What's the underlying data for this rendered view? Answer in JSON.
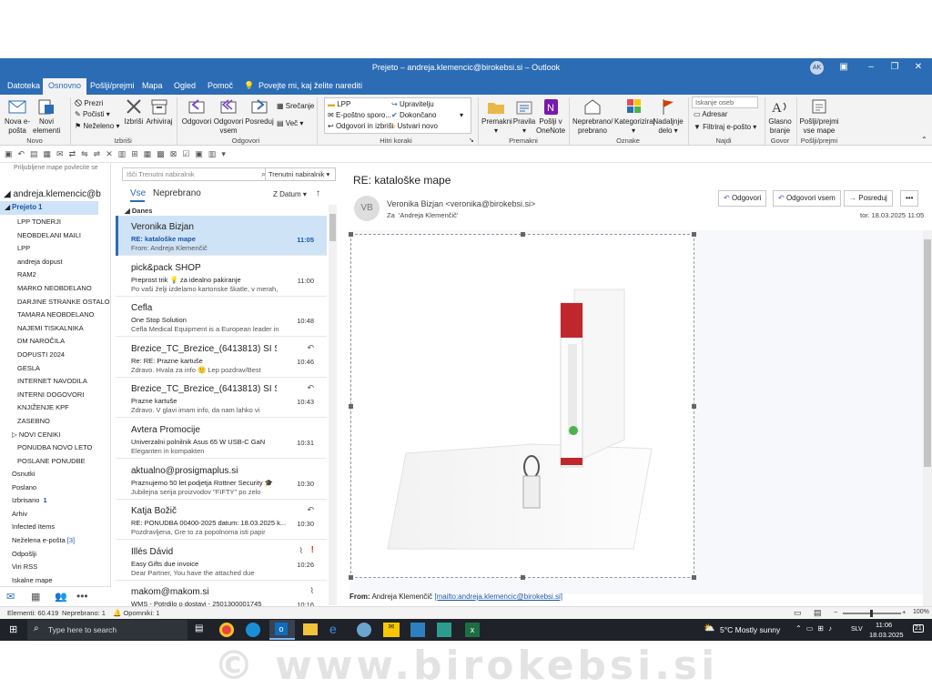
{
  "window": {
    "title": "Prejeto – andreja.klemencic@birokebsi.si – Outlook",
    "avatar_initials": "AK"
  },
  "tabs": [
    "Datoteka",
    "Osnovno",
    "Pošlji/prejmi",
    "Mapa",
    "Ogled",
    "Pomoč"
  ],
  "tell_me": "Povejte mi, kaj želite narediti",
  "ribbon": {
    "new_email": "Nova e-pošta",
    "new_items": "Novi elementi",
    "group_new": "Novo",
    "ignore": "Prezri",
    "clean": "Počisti",
    "junk": "Neželeno",
    "delete": "Izbriši",
    "archive": "Arhiviraj",
    "group_delete": "Izbriši",
    "reply": "Odgovori",
    "reply_all": "Odgovori vsem",
    "forward": "Posreduj",
    "meeting": "Srečanje",
    "more": "Več",
    "group_respond": "Odgovori",
    "qs_lpp": "LPP",
    "qs_email_manager": "E-poštno sporo...",
    "qs_reply_delete": "Odgovori in izbriši",
    "qs_manager": "Upravitelju",
    "qs_done": "Dokončano",
    "qs_create_new": "Ustvari novo",
    "group_quicksteps": "Hitri koraki",
    "move": "Premakni",
    "rules": "Pravila",
    "onenote": "Pošlji v OneNote",
    "group_move": "Premakni",
    "unread_read": "Neprebrano/ prebrano",
    "categorize": "Kategoriziraj",
    "followup": "Nadaljnje delo",
    "group_tags": "Oznake",
    "search_people": "Iskanje oseb",
    "address_book": "Adresar",
    "filter_email": "Filtriraj e-pošto",
    "group_find": "Najdi",
    "read_aloud": "Glasno branje",
    "group_speech": "Govor",
    "send_receive_all": "Pošlji/prejmi vse mape",
    "group_send_receive": "Pošlji/prejmi"
  },
  "nav": {
    "favorites_hint": "Priljubljene mape povlecite se",
    "account": "andreja.klemencic@b",
    "inbox": "Prejeto",
    "inbox_count": "1",
    "folders": [
      "LPP TONERJI",
      "NEOBDELANI MAILI",
      "LPP",
      "andreja dopust",
      "RAM2",
      "MARKO NEOBDELANO",
      "DARJINE STRANKE OSTALO",
      "TAMARA NEOBDELANO",
      "NAJEMI TISKALNIKA",
      "DM NAROČILA",
      "DOPUSTI 2024",
      "GESLA",
      "INTERNET NAVODILA",
      "INTERNI DOGOVORI",
      "KNJIŽENJE KPF",
      "ZASEBNO",
      "NOVI CENIKI",
      "PONUDBA NOVO LETO",
      "POSLANE PONUDBE"
    ],
    "top_folders": [
      "Osnutki",
      "Poslano",
      "Izbrisano",
      "Arhiv",
      "Infected Items",
      "Neželena e-pošta",
      "Odpošlji",
      "Viri RSS",
      "Iskalne mape"
    ],
    "deleted_count": "1",
    "junk_count": "[3]"
  },
  "list": {
    "search_placeholder": "Išči Trenutni nabiralnik",
    "scope": "Trenutni nabiralnik",
    "filter_all": "Vse",
    "filter_unread": "Neprebrano",
    "sort": "Z Datum",
    "group_today": "Danes",
    "messages": [
      {
        "from": "Veronika Bizjan",
        "subject": "RE: kataloške mape",
        "preview": "From: Andreja Klemenčič",
        "time": "11:05"
      },
      {
        "from": "pick&pack SHOP",
        "subject": "Preprost trik 💡 za idealno pakiranje",
        "preview": "Po vaši želji izdelamo kartonske škatle, v merah,",
        "time": "11:00"
      },
      {
        "from": "Cefla",
        "subject": "One Stop Solution",
        "preview": "Cefla Medical Equipment is a European leader in",
        "time": "10:48"
      },
      {
        "from": "Brezice_TC_Brezice_(6413813) SI Slo...",
        "subject": "Re: RE: Prazne kartuše",
        "preview": "Zdravo. Hvala za info 🙂 Lep pozdrav/Best",
        "time": "10:46"
      },
      {
        "from": "Brezice_TC_Brezice_(6413813) SI Slo...",
        "subject": "Prazne kartuše",
        "preview": "Zdravo. V glavi imam info, da nam lahko vi",
        "time": "10:43"
      },
      {
        "from": "Avtera Promocije",
        "subject": "Univerzalni polnilnik Asus 65 W USB-C GaN",
        "preview": "Eleganten in kompakten",
        "time": "10:31"
      },
      {
        "from": "aktualno@prosigmaplus.si",
        "subject": "Praznujemo 50 let podjetja Rottner Security 🎓",
        "preview": "Jubilejna serija proizvodov \"FIFTY\" po zelo",
        "time": "10:30"
      },
      {
        "from": "Katja Božič",
        "subject": "RE: PONUDBA 00400-2025 datum: 18.03.2025 k...",
        "preview": "Pozdravljena, Gre to za popolnoma isti papir",
        "time": "10:30"
      },
      {
        "from": "Illés Dávid",
        "subject": "Easy Gifts due invoice",
        "preview": "Dear Partner, You have the attached due",
        "time": "10:26"
      },
      {
        "from": "makom@makom.si",
        "subject": "WMS - Potrdilo o dostavi - 2501300001745",
        "preview": "",
        "time": "10:16"
      }
    ]
  },
  "reading": {
    "subject": "RE: kataloške mape",
    "avatar": "VB",
    "sender": "Veronika Bizjan <veronika@birokebsi.si>",
    "to_label": "Za",
    "to": "'Andreja Klemenčič'",
    "date": "tor. 18.03.2025 11:05",
    "btn_reply": "Odgovori",
    "btn_reply_all": "Odgovori vsem",
    "btn_forward": "Posreduj",
    "from_line_label": "From:",
    "from_line_name": "Andreja Klemenčič",
    "from_line_link": "[mailto:andreja.klemencic@birokebsi.si]"
  },
  "status": {
    "items": "Elementi: 60.419",
    "unread": "Neprebrano: 1",
    "reminders": "Opomniki: 1",
    "zoom": "100%"
  },
  "taskbar": {
    "search": "Type here to search",
    "weather": "5°C  Mostly sunny",
    "lang": "SLV",
    "time": "11:06",
    "date": "18.03.2025",
    "notif": "21"
  },
  "watermark": "© www.birokebsi.si",
  "colors": {
    "accent": "#2b6cb5",
    "link": "#1a55a8",
    "selected_bg": "#cfe3f7",
    "flag": "#d83b01"
  }
}
